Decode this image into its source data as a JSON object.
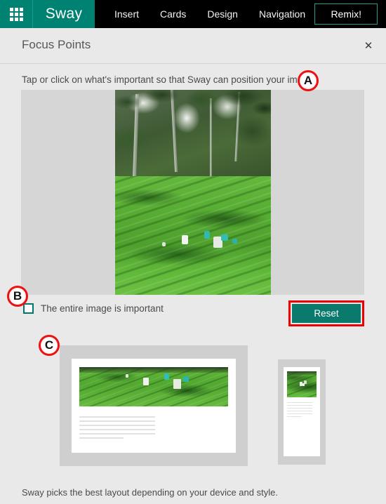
{
  "appbar": {
    "waffle_icon": "app-launcher-grid-icon",
    "brand": "Sway",
    "nav_items": [
      {
        "label": "Insert"
      },
      {
        "label": "Cards"
      },
      {
        "label": "Design"
      },
      {
        "label": "Navigation"
      }
    ],
    "remix_label": "Remix!",
    "brand_color": "#008272",
    "bar_color": "#000000"
  },
  "dialog": {
    "title": "Focus Points",
    "close_icon": "close-icon",
    "close_glyph": "✕",
    "instruction": "Tap or click on what's important so that Sway can position your image",
    "checkbox": {
      "label": "The entire image is important",
      "checked": false,
      "accent_color": "#00796b"
    },
    "reset_label": "Reset",
    "reset_color": "#0a7a6c",
    "footer_note": "Sway picks the best layout depending on your device and style."
  },
  "previews": {
    "desktop": {
      "name": "desktop-layout-preview"
    },
    "mobile": {
      "name": "mobile-layout-preview"
    }
  },
  "annotations": {
    "color": "#ee1111",
    "markers": [
      {
        "letter": "A",
        "target": "image-canvas"
      },
      {
        "letter": "B",
        "target": "entire-image-checkbox"
      },
      {
        "letter": "C",
        "target": "layout-previews"
      }
    ]
  }
}
